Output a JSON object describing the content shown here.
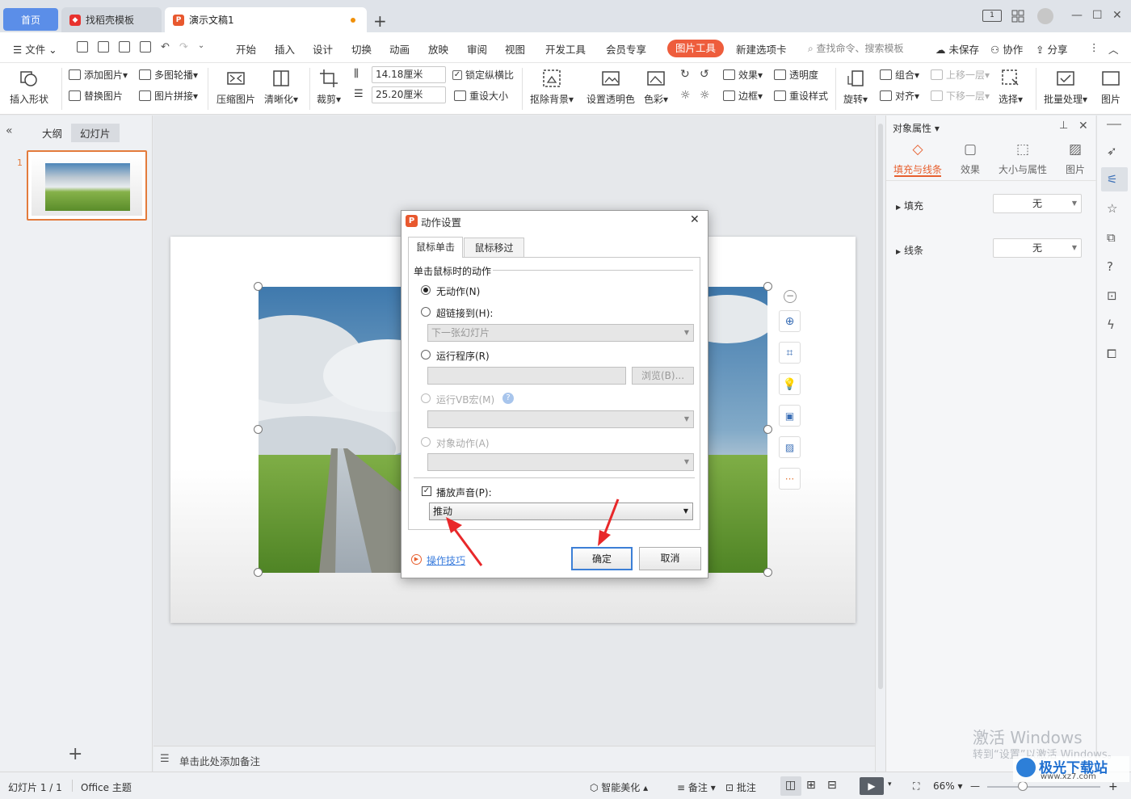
{
  "titlebar": {
    "home_tab": "首页",
    "template_tab": "找稻壳模板",
    "doc_tab": "演示文稿1",
    "new_tab": "+",
    "page_indicator": "1"
  },
  "menu": {
    "file": "文件",
    "items": [
      "开始",
      "插入",
      "设计",
      "切换",
      "动画",
      "放映",
      "审阅",
      "视图",
      "开发工具",
      "会员专享"
    ],
    "active": "图片工具",
    "new_tab": "新建选项卡",
    "search_placeholder": "查找命令、搜索模板",
    "unsaved": "未保存",
    "collab": "协作",
    "share": "分享"
  },
  "ribbon": {
    "insert_shape": "插入形状",
    "add_picture": "添加图片",
    "replace_picture": "替换图片",
    "multi_carousel": "多图轮播",
    "picture_collage": "图片拼接",
    "compress": "压缩图片",
    "clarity": "清晰化",
    "crop": "裁剪",
    "width": "14.18厘米",
    "height": "25.20厘米",
    "lock_ratio": "锁定纵横比",
    "reset_size": "重设大小",
    "remove_bg": "抠除背景",
    "set_transparent": "设置透明色",
    "color": "色彩",
    "effects": "效果",
    "transparency": "透明度",
    "border": "边框",
    "reset_style": "重设样式",
    "rotate": "旋转",
    "group": "组合",
    "align": "对齐",
    "bring_forward": "上移一层",
    "send_backward": "下移一层",
    "select": "选择",
    "batch": "批量处理",
    "picture": "图片"
  },
  "left_panel": {
    "tab_outline": "大纲",
    "tab_slides": "幻灯片",
    "slide_number": "1",
    "add": "+"
  },
  "notes": {
    "placeholder": "单击此处添加备注"
  },
  "right_panel": {
    "title": "对象属性",
    "tabs": [
      "填充与线条",
      "效果",
      "大小与属性",
      "图片"
    ],
    "fill_label": "填充",
    "fill_value": "无",
    "line_label": "线条",
    "line_value": "无"
  },
  "dialog": {
    "title": "动作设置",
    "tab_click": "鼠标单击",
    "tab_hover": "鼠标移过",
    "group_label": "单击鼠标时的动作",
    "no_action": "无动作(N)",
    "hyperlink": "超链接到(H):",
    "hyperlink_value": "下一张幻灯片",
    "run_program": "运行程序(R)",
    "browse": "浏览(B)...",
    "run_macro": "运行VB宏(M)",
    "object_action": "对象动作(A)",
    "play_sound": "播放声音(P):",
    "sound_value": "推动",
    "tips": "操作技巧",
    "ok": "确定",
    "cancel": "取消"
  },
  "status": {
    "slide_info": "幻灯片 1 / 1",
    "theme": "Office 主题",
    "beautify": "智能美化",
    "notes": "备注",
    "comments": "批注",
    "zoom": "66%"
  },
  "watermark": {
    "line1": "激活 Windows",
    "line2": "转到“设置”以激活 Windows。",
    "site_name": "极光下载站",
    "site_url": "www.xz7.com"
  },
  "colors": {
    "accent_orange": "#ee5d3c",
    "home_blue": "#5b8ee8",
    "arrow_red": "#e8282a",
    "link_blue": "#3b7ddd"
  }
}
